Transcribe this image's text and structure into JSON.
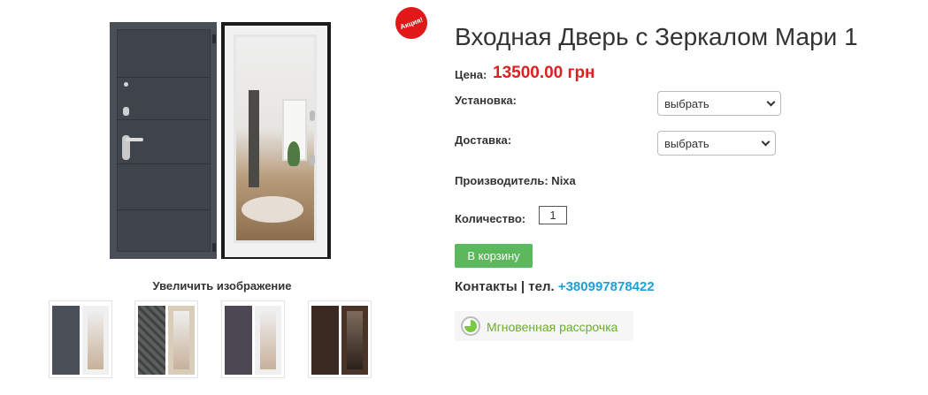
{
  "product": {
    "title": "Входная Дверь с Зеркалом Мари 1",
    "badge": "Акция!",
    "price_label": "Цена:",
    "price_value": "13500.00 грн",
    "enlarge_label": "Увеличить изображение",
    "manufacturer": "Производитель: Nixa"
  },
  "options": {
    "installation_label": "Установка:",
    "installation_value": "выбрать",
    "delivery_label": "Доставка:",
    "delivery_value": "выбрать",
    "quantity_label": "Количество:",
    "quantity_value": "1"
  },
  "actions": {
    "cart_label": "В корзину"
  },
  "contacts": {
    "label": "Контакты | тел.",
    "phone": "+380997878422"
  },
  "installment": {
    "label": "Мгновенная рассрочка"
  },
  "colors": {
    "price": "#e01f1f",
    "cart_button": "#5cb85c",
    "phone": "#1ba1d6",
    "installment_text": "#6aae2d",
    "badge": "#e01818"
  },
  "thumbnails": [
    {
      "name": "door-thumb-1"
    },
    {
      "name": "door-thumb-2"
    },
    {
      "name": "door-thumb-3"
    },
    {
      "name": "door-thumb-4"
    }
  ]
}
